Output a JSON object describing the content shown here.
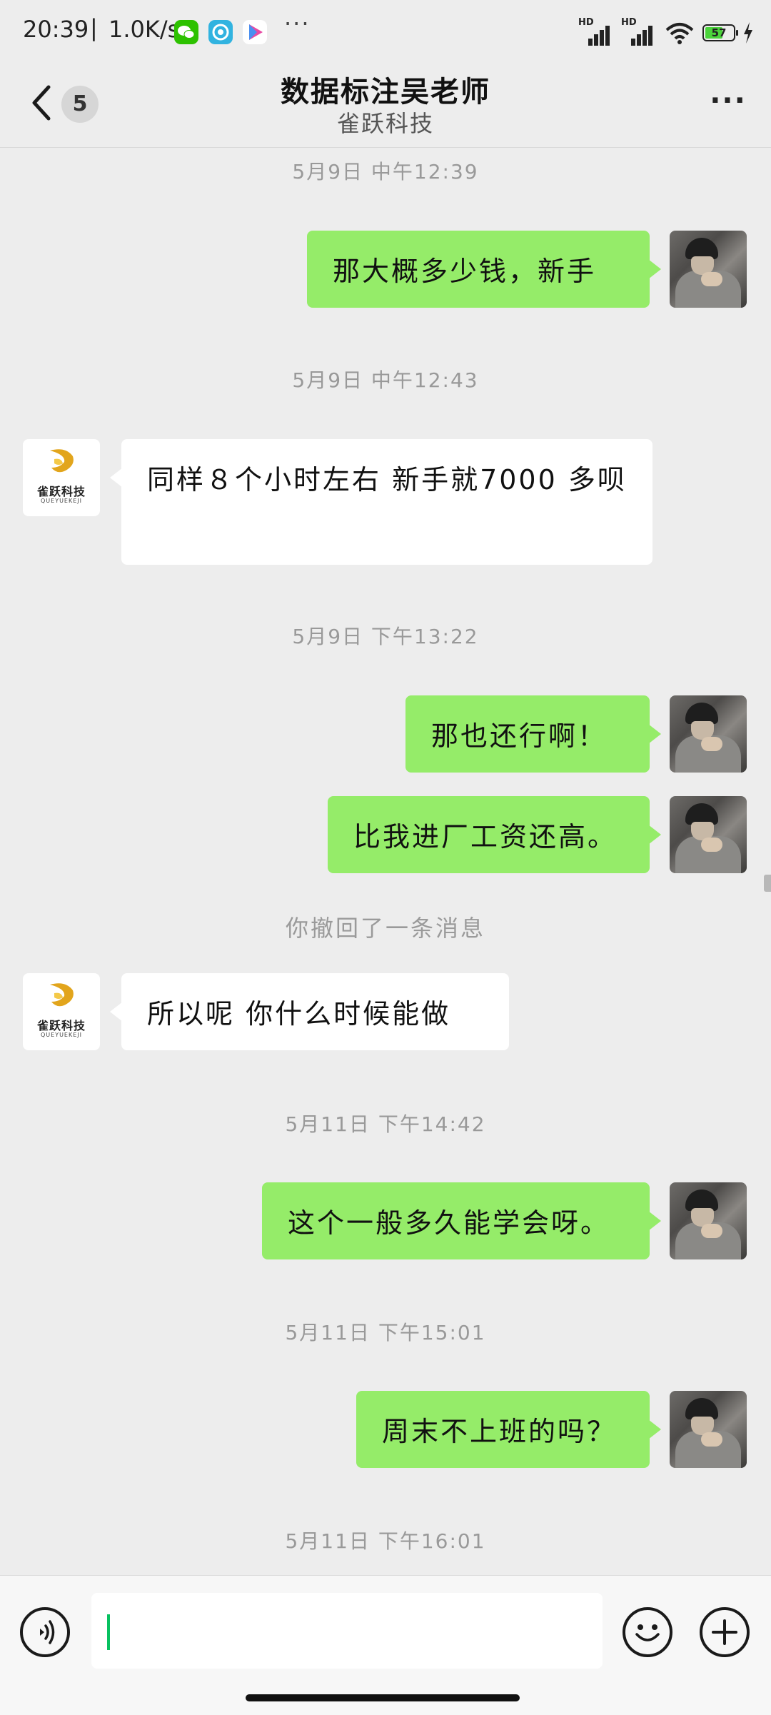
{
  "status_bar": {
    "time": "20:39",
    "separator": "|",
    "net_speed": "1.0K/s",
    "more": "···",
    "signal_label": "HD",
    "battery_level": "57",
    "apps": [
      {
        "icon": "wechat-icon",
        "color": "#2dc100"
      },
      {
        "icon": "browser-icon",
        "color": "#31b3e0"
      },
      {
        "icon": "video-app-icon",
        "color": "#ffffff"
      }
    ]
  },
  "header": {
    "title": "数据标注吴老师",
    "subtitle": "雀跃科技",
    "unread_count": "5",
    "more": "···"
  },
  "avatar": {
    "company_name": "雀跃科技",
    "company_sub": "QUEYUEKEJI"
  },
  "messages": [
    {
      "type": "time",
      "text": "5月9日 中午12:39"
    },
    {
      "type": "me",
      "text": "那大概多少钱，新手"
    },
    {
      "type": "time",
      "text": "5月9日 中午12:43"
    },
    {
      "type": "them",
      "text": "同样８个小时左右 新手就7000 多呗"
    },
    {
      "type": "time",
      "text": "5月9日 下午13:22"
    },
    {
      "type": "me",
      "text": "那也还行啊！"
    },
    {
      "type": "me",
      "text": "比我进厂工资还高。"
    },
    {
      "type": "system",
      "text": "你撤回了一条消息"
    },
    {
      "type": "them",
      "text": "所以呢 你什么时候能做"
    },
    {
      "type": "time",
      "text": "5月11日 下午14:42"
    },
    {
      "type": "me",
      "text": "这个一般多久能学会呀。"
    },
    {
      "type": "time",
      "text": "5月11日 下午15:01"
    },
    {
      "type": "me",
      "text": "周末不上班的吗？"
    },
    {
      "type": "time",
      "text": "5月11日 下午16:01"
    }
  ],
  "input": {
    "value": "",
    "placeholder": ""
  },
  "colors": {
    "bubble_me": "#95ec69",
    "bubble_them": "#ffffff",
    "background": "#ededed",
    "caret": "#07c160"
  }
}
